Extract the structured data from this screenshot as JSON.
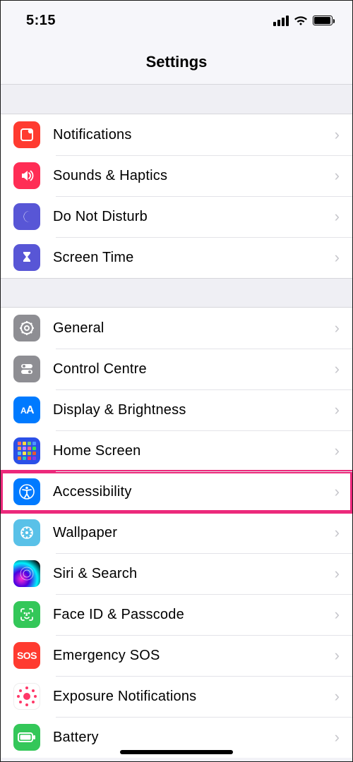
{
  "status": {
    "time": "5:15"
  },
  "header": {
    "title": "Settings"
  },
  "groups": [
    {
      "items": [
        {
          "key": "notifications",
          "label": "Notifications"
        },
        {
          "key": "sounds",
          "label": "Sounds & Haptics"
        },
        {
          "key": "dnd",
          "label": "Do Not Disturb"
        },
        {
          "key": "screentime",
          "label": "Screen Time"
        }
      ]
    },
    {
      "items": [
        {
          "key": "general",
          "label": "General"
        },
        {
          "key": "controlcentre",
          "label": "Control Centre"
        },
        {
          "key": "display",
          "label": "Display & Brightness"
        },
        {
          "key": "homescreen",
          "label": "Home Screen"
        },
        {
          "key": "accessibility",
          "label": "Accessibility",
          "highlight": true
        },
        {
          "key": "wallpaper",
          "label": "Wallpaper"
        },
        {
          "key": "siri",
          "label": "Siri & Search"
        },
        {
          "key": "faceid",
          "label": "Face ID & Passcode"
        },
        {
          "key": "sos",
          "label": "Emergency SOS"
        },
        {
          "key": "exposure",
          "label": "Exposure Notifications"
        },
        {
          "key": "battery",
          "label": "Battery"
        }
      ]
    }
  ]
}
